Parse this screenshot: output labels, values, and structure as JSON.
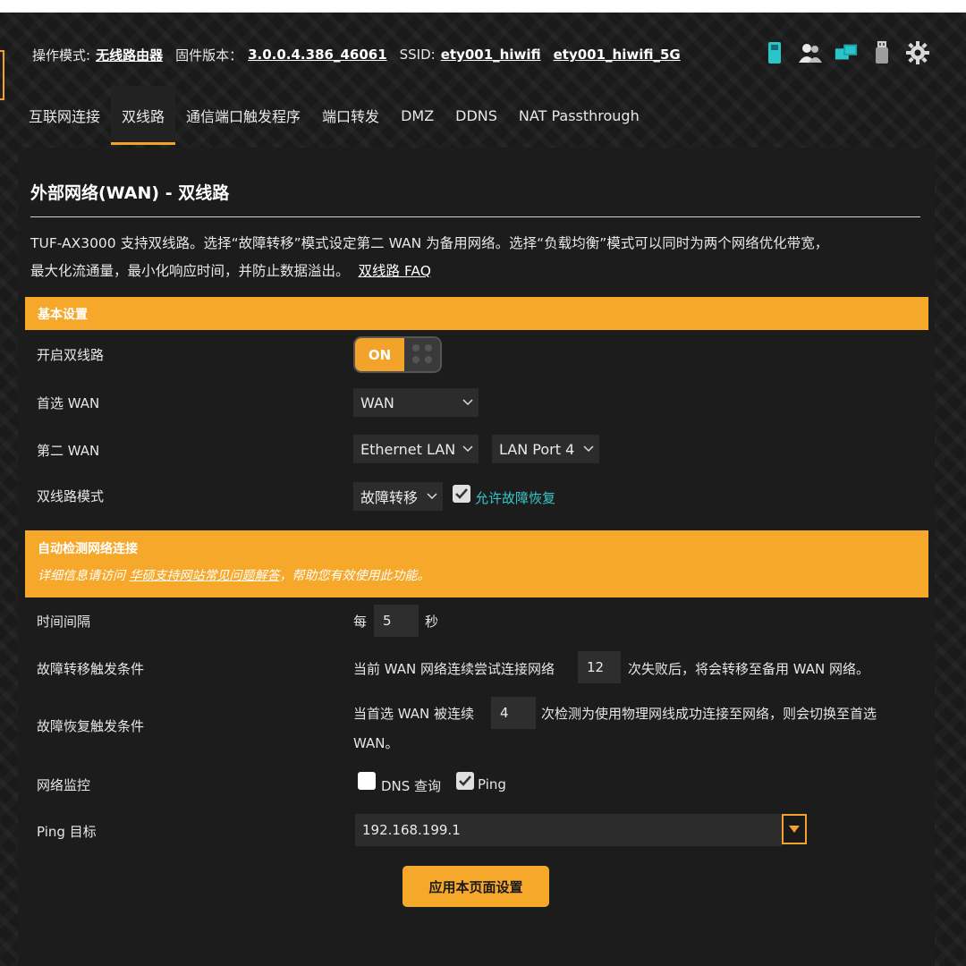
{
  "status": {
    "mode_label": "操作模式:",
    "mode_value": "无线路由器",
    "firmware_label": "固件版本：",
    "firmware_value": "3.0.0.4.386_46061",
    "ssid_label": "SSID:",
    "ssid_1": "ety001_hiwifi",
    "ssid_2": "ety001_hiwifi_5G",
    "icons": [
      "sim-card-icon",
      "users-icon",
      "network-devices-icon",
      "usb-icon",
      "settings-icon"
    ]
  },
  "tabs": [
    {
      "label": "互联网连接",
      "active": false
    },
    {
      "label": "双线路",
      "active": true
    },
    {
      "label": "通信端口触发程序",
      "active": false
    },
    {
      "label": "端口转发",
      "active": false
    },
    {
      "label": "DMZ",
      "active": false
    },
    {
      "label": "DDNS",
      "active": false
    },
    {
      "label": "NAT Passthrough",
      "active": false
    }
  ],
  "panel": {
    "title": "外部网络(WAN) - 双线路",
    "desc_line1": "TUF-AX3000 支持双线路。选择“故障转移”模式设定第二 WAN 为备用网络。选择“负载均衡”模式可以同时为两个网络优化带宽，",
    "desc_line2": "最大化流通量，最小化响应时间，并防止数据溢出。",
    "faq_link": "双线路 FAQ"
  },
  "basic": {
    "header": "基本设置",
    "enable_label": "开启双线路",
    "toggle_text": "ON",
    "primary_label": "首选 WAN",
    "primary_value": "WAN",
    "secondary_label": "第二 WAN",
    "secondary_value": "Ethernet LAN",
    "secondary_port": "LAN Port 4",
    "mode_label": "双线路模式",
    "mode_value": "故障转移",
    "failback_label": "允许故障恢复"
  },
  "detect": {
    "header": "自动检测网络连接",
    "sub_prefix": "详细信息请访问 ",
    "sub_link": "华硕支持网站常见问题解答",
    "sub_suffix": "，帮助您有效使用此功能。",
    "interval_label": "时间间隔",
    "interval_prefix": "每",
    "interval_value": "5",
    "interval_suffix": "秒",
    "failover_label": "故障转移触发条件",
    "failover_prefix": "当前 WAN 网络连续尝试连接网络",
    "failover_value": "12",
    "failover_suffix": "次失败后，将会转移至备用 WAN 网络。",
    "failback_cond_label": "故障恢复触发条件",
    "failback_prefix": "当首选 WAN 被连续",
    "failback_value": "4",
    "failback_suffix": "次检测为使用物理网线成功连接至网络，则会切换至首选",
    "failback_suffix2": "WAN。",
    "monitor_label": "网络监控",
    "dns_label": "DNS 查询",
    "ping_label": "Ping",
    "ping_target_label": "Ping 目标",
    "ping_target_value": "192.168.199.1"
  },
  "apply_label": "应用本页面设置",
  "colors": {
    "accent": "#f6a82b",
    "panel": "#1c1c1c",
    "input": "#2c2c2c",
    "link_teal": "#36c7c7"
  }
}
